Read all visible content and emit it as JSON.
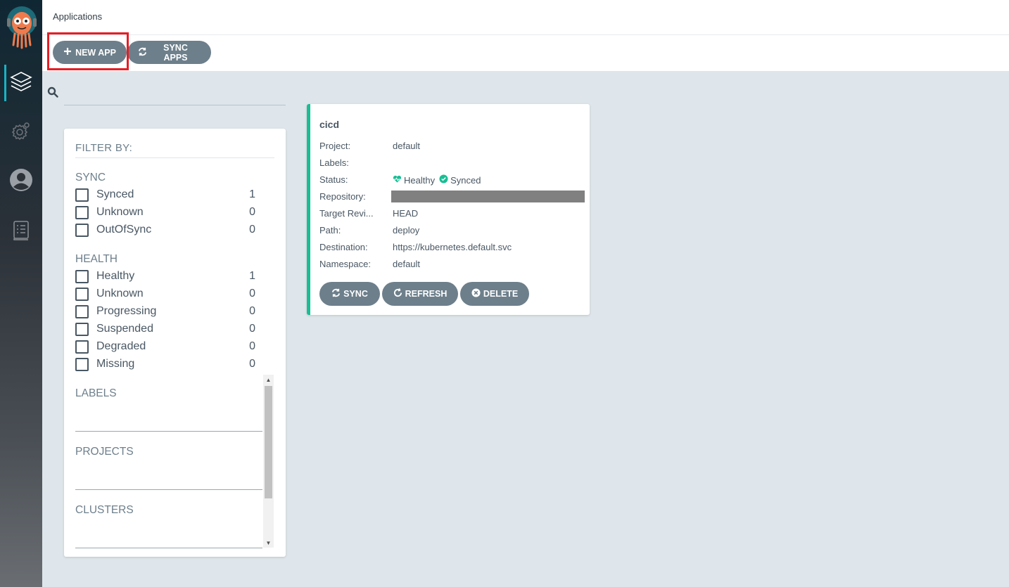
{
  "header": {
    "title": "Applications"
  },
  "toolbar": {
    "new_app_label": "NEW APP",
    "sync_apps_label": "SYNC APPS"
  },
  "nav": {
    "items": [
      {
        "icon": "layers-icon",
        "active": true
      },
      {
        "icon": "gear-icon",
        "active": false
      },
      {
        "icon": "user-icon",
        "active": false
      },
      {
        "icon": "docs-icon",
        "active": false
      }
    ]
  },
  "search": {
    "value": "",
    "placeholder": ""
  },
  "filter": {
    "title": "FILTER BY:",
    "sync": {
      "title": "SYNC",
      "items": [
        {
          "label": "Synced",
          "count": "1"
        },
        {
          "label": "Unknown",
          "count": "0"
        },
        {
          "label": "OutOfSync",
          "count": "0"
        }
      ]
    },
    "health": {
      "title": "HEALTH",
      "items": [
        {
          "label": "Healthy",
          "count": "1"
        },
        {
          "label": "Unknown",
          "count": "0"
        },
        {
          "label": "Progressing",
          "count": "0"
        },
        {
          "label": "Suspended",
          "count": "0"
        },
        {
          "label": "Degraded",
          "count": "0"
        },
        {
          "label": "Missing",
          "count": "0"
        }
      ]
    },
    "labels_title": "LABELS",
    "projects_title": "PROJECTS",
    "clusters_title": "CLUSTERS"
  },
  "app": {
    "name": "cicd",
    "fields": {
      "project_key": "Project:",
      "project_val": "default",
      "labels_key": "Labels:",
      "labels_val": "",
      "status_key": "Status:",
      "health_val": "Healthy",
      "sync_val": "Synced",
      "repo_key": "Repository:",
      "target_key": "Target Revi...",
      "target_val": "HEAD",
      "path_key": "Path:",
      "path_val": "deploy",
      "dest_key": "Destination:",
      "dest_val": "https://kubernetes.default.svc",
      "ns_key": "Namespace:",
      "ns_val": "default"
    },
    "buttons": {
      "sync": "SYNC",
      "refresh": "REFRESH",
      "delete": "DELETE"
    },
    "status_color": "#18be94"
  },
  "colors": {
    "accent": "#17b3c4",
    "button": "#6d7f8b",
    "highlight": "#e51e25",
    "healthy": "#18be94"
  }
}
